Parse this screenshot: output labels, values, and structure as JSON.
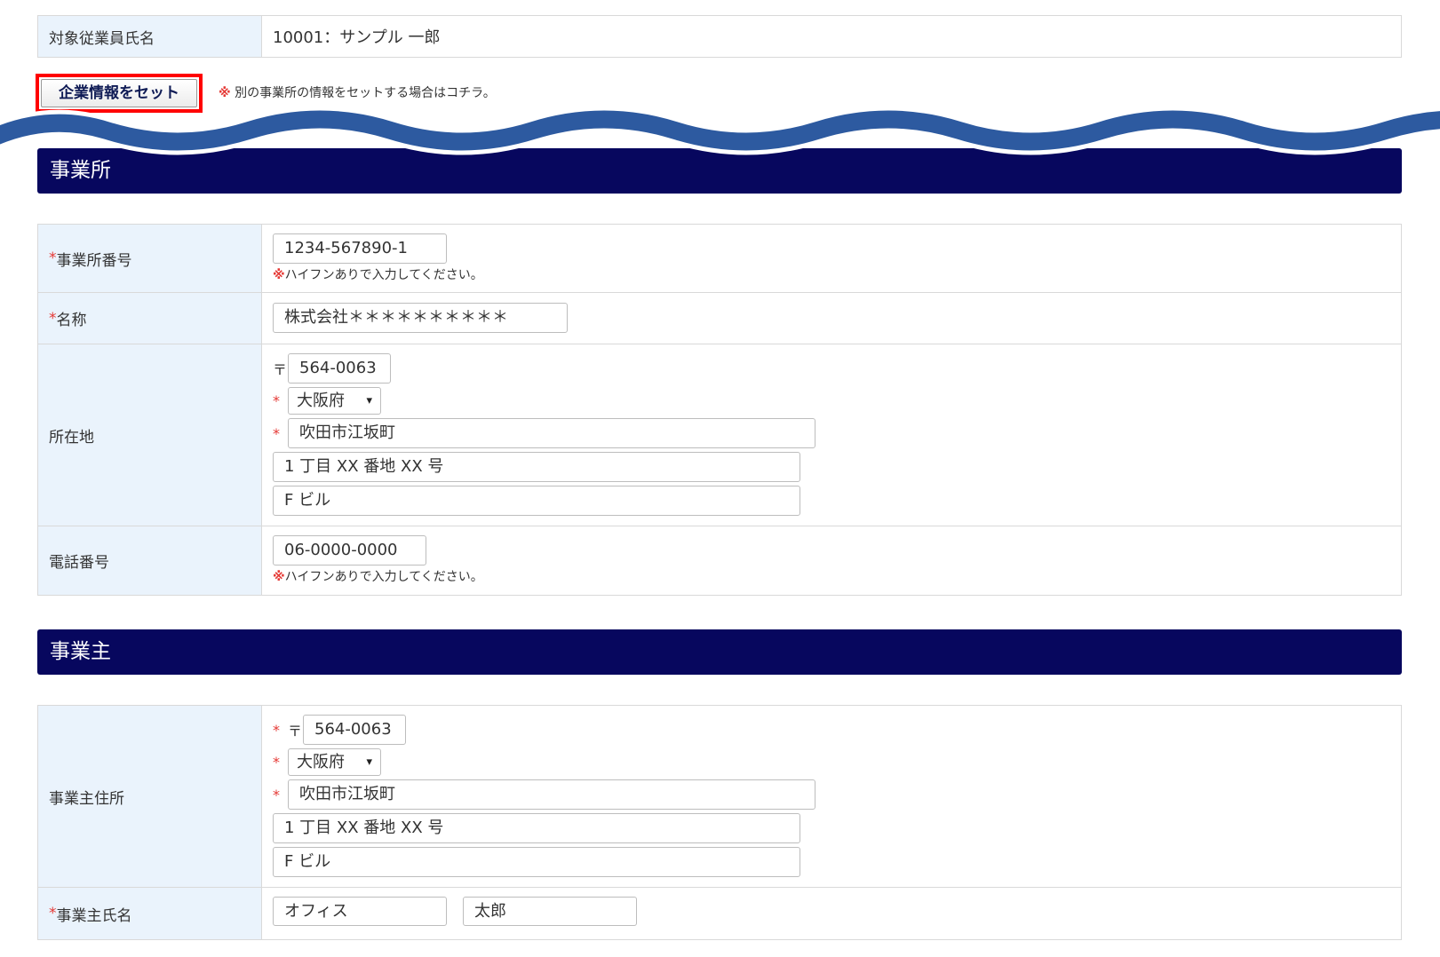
{
  "employee": {
    "label": "対象従業員氏名",
    "value": "10001：サンプル 一郎"
  },
  "set_button": {
    "label": "企業情報をセット",
    "note_mark": "※",
    "note": "別の事業所の情報をセットする場合はコチラ。"
  },
  "office": {
    "heading": "事業所",
    "number": {
      "req": "*",
      "label": "事業所番号",
      "value": "1234-567890-1",
      "note_mark": "※",
      "note": "ハイフンありで入力してください。"
    },
    "name": {
      "req": "*",
      "label": "名称",
      "value": "株式会社＊＊＊＊＊＊＊＊＊＊"
    },
    "address": {
      "label": "所在地",
      "postal_mark": "〒",
      "postal": "564-0063",
      "req": "*",
      "prefecture": "大阪府",
      "city": "吹田市江坂町",
      "street": "1 丁目 XX 番地 XX 号",
      "building": "F ビル"
    },
    "phone": {
      "label": "電話番号",
      "value": "06-0000-0000",
      "note_mark": "※",
      "note": "ハイフンありで入力してください。"
    }
  },
  "owner": {
    "heading": "事業主",
    "address": {
      "label": "事業主住所",
      "req": "*",
      "postal_mark": "〒",
      "postal": "564-0063",
      "prefecture": "大阪府",
      "city": "吹田市江坂町",
      "street": "1 丁目 XX 番地 XX 号",
      "building": "F ビル"
    },
    "name": {
      "req": "*",
      "label": "事業主氏名",
      "last": "オフィス",
      "first": "太郎"
    }
  },
  "icons": {
    "dropdown": "chevron-down-icon"
  },
  "colors": {
    "heading_band": "#07075e",
    "label_bg": "#eaf3fc",
    "required": "#e53935",
    "highlight": "#ff0000",
    "wave": "#2d5aa0"
  }
}
